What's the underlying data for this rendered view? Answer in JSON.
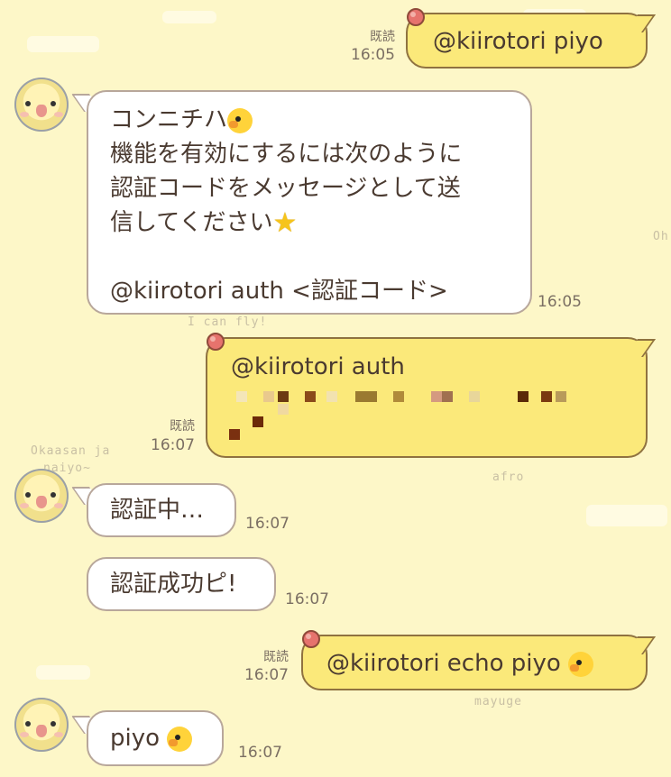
{
  "messages": [
    {
      "text": "@kiirotori piyo",
      "read": "既読",
      "time": "16:05"
    },
    {
      "lines": [
        "コンニチハ",
        "機能を有効にするには次のように",
        "認証コードをメッセージとして送",
        "信してください",
        "",
        "@kiirotori auth <認証コード>"
      ],
      "time": "16:05"
    },
    {
      "text": "@kiirotori auth",
      "read": "既読",
      "time": "16:07"
    },
    {
      "text": "認証中…",
      "time": "16:07"
    },
    {
      "text": "認証成功ピ!",
      "time": "16:07"
    },
    {
      "text": "@kiirotori echo piyo",
      "read": "既読",
      "time": "16:07"
    },
    {
      "text": "piyo",
      "time": "16:07"
    }
  ],
  "background_doodles": [
    "I can fly!",
    "Okaasan ja",
    "naiyo~",
    "afro",
    "mayuge",
    "Oh"
  ],
  "colors": {
    "background": "#fdf7c8",
    "incoming_bubble": "#ffffff",
    "outgoing_bubble": "#fbe97a",
    "text": "#4a3a30"
  },
  "icons": [
    "chick-avatar",
    "chick-emoji",
    "star-emoji",
    "bubble-flag-icon"
  ]
}
